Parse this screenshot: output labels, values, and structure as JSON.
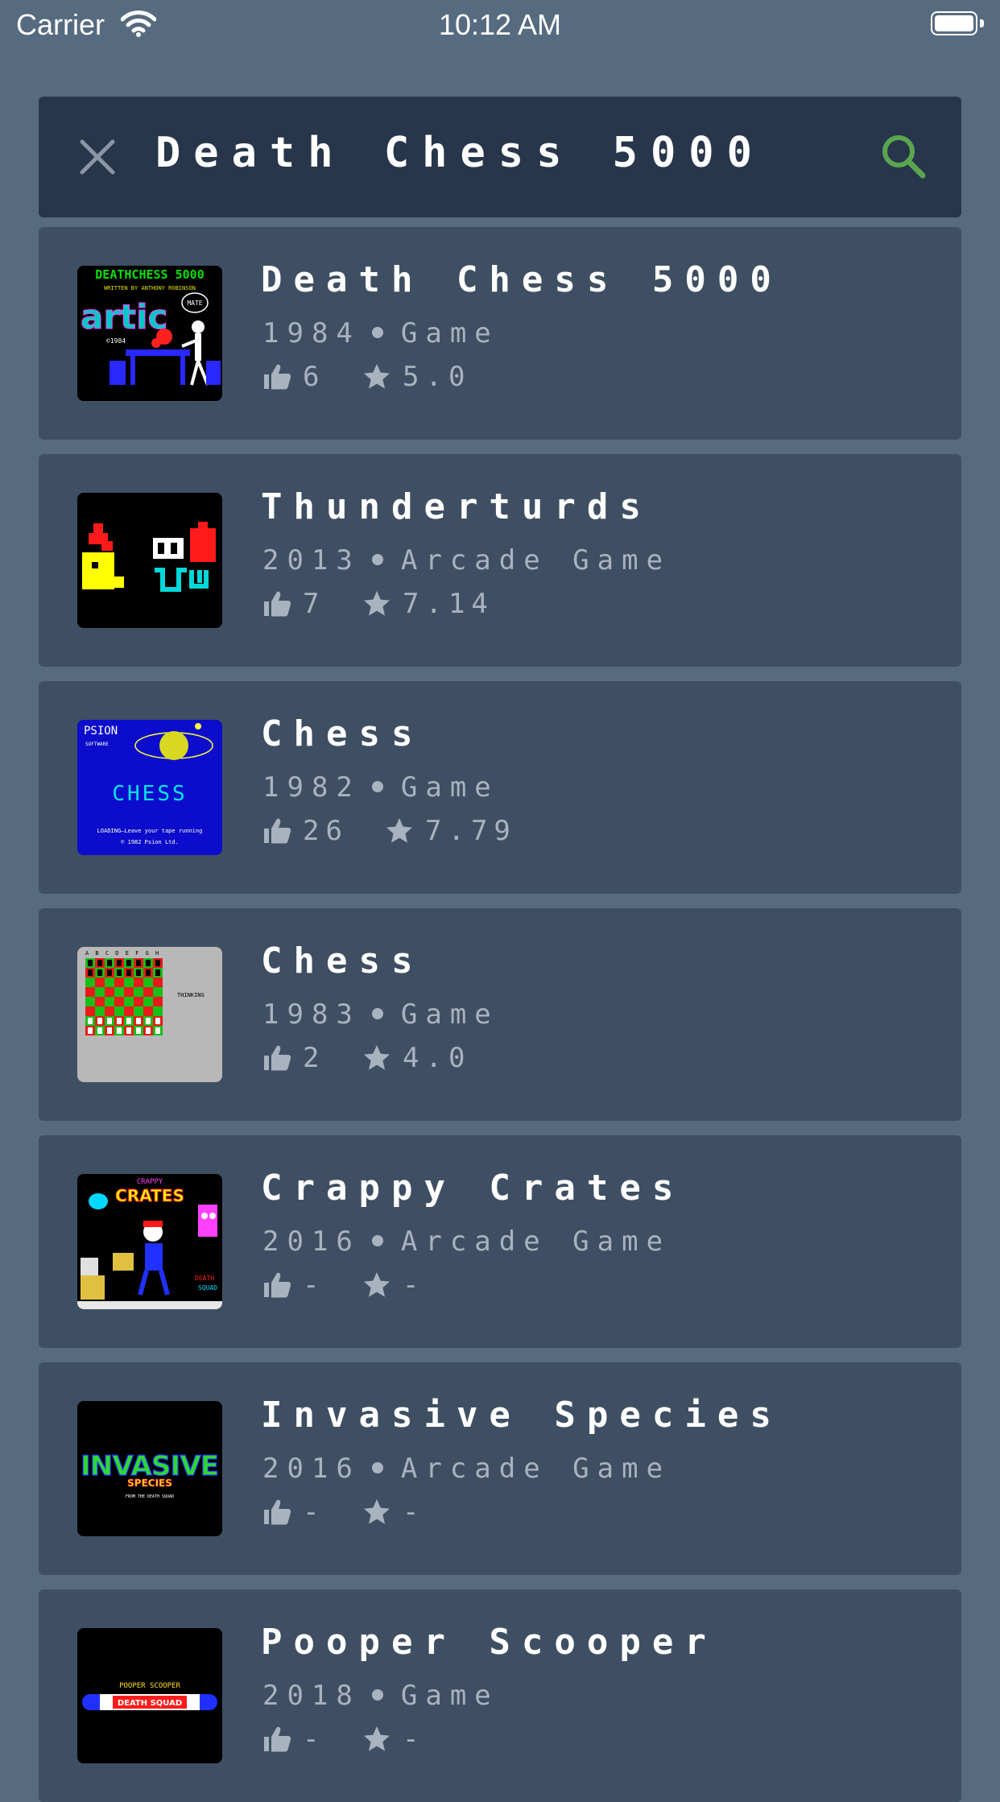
{
  "status_bar": {
    "carrier": "Carrier",
    "time": "10:12 AM"
  },
  "search": {
    "query": "Death Chess 5000"
  },
  "results": [
    {
      "title": "Death Chess 5000",
      "year": "1984",
      "genre": "Game",
      "likes": "6",
      "rating": "5.0",
      "thumb": "deathchess"
    },
    {
      "title": "Thunderturds",
      "year": "2013",
      "genre": "Arcade Game",
      "likes": "7",
      "rating": "7.14",
      "thumb": "thunderturds"
    },
    {
      "title": "Chess",
      "year": "1982",
      "genre": "Game",
      "likes": "26",
      "rating": "7.79",
      "thumb": "psion"
    },
    {
      "title": "Chess",
      "year": "1983",
      "genre": "Game",
      "likes": "2",
      "rating": "4.0",
      "thumb": "chessboard"
    },
    {
      "title": "Crappy Crates",
      "year": "2016",
      "genre": "Arcade Game",
      "likes": "-",
      "rating": "-",
      "thumb": "crates"
    },
    {
      "title": "Invasive Species",
      "year": "2016",
      "genre": "Arcade Game",
      "likes": "-",
      "rating": "-",
      "thumb": "invasive"
    },
    {
      "title": "Pooper Scooper",
      "year": "2018",
      "genre": "Game",
      "likes": "-",
      "rating": "-",
      "thumb": "pooper"
    }
  ],
  "thumb_texts": {
    "deathchess": {
      "line1": "DEATHCHESS 5000",
      "line2": "WRITTEN BY ANTHONY ROBINSON",
      "logo": "artic",
      "badge": "MATE",
      "year": "©1984"
    },
    "psion": {
      "brand": "PSION",
      "sub": "SOFTWARE",
      "name": "CHESS",
      "loading": "LOADING—Leave your tape running",
      "copy": "© 1982 Psion Ltd."
    },
    "chessboard": {
      "files": "A B C D E F G H",
      "status": "THINKING"
    },
    "crates": {
      "top": "CRAPPY",
      "main": "CRATES",
      "squad1": "DEATH",
      "squad2": "SQUAD"
    },
    "invasive": {
      "main": "INVASIVE",
      "sub": "SPECIES",
      "tag": "FROM THE DEATH SQUAD"
    },
    "pooper": {
      "top": "POOPER SCOOPER",
      "band": "DEATH SQUAD"
    }
  },
  "colors": {
    "background": "#566b80",
    "search_bar": "#27364a",
    "card": "#3f4f63",
    "muted_text": "#a9b2bf",
    "search_icon": "#5aa64f"
  }
}
